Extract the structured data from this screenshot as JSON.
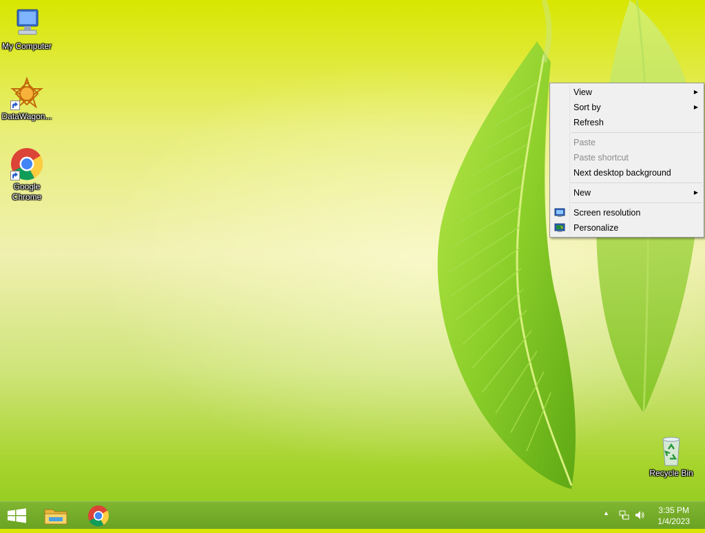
{
  "desktop": {
    "icons": [
      {
        "label": "My Computer"
      },
      {
        "label": "DataWagon..."
      },
      {
        "label": "Google Chrome"
      },
      {
        "label": "Recycle Bin"
      }
    ]
  },
  "context_menu": {
    "items": [
      {
        "label": "View",
        "has_submenu": true
      },
      {
        "label": "Sort by",
        "has_submenu": true
      },
      {
        "label": "Refresh"
      },
      {
        "label": "Paste",
        "disabled": true
      },
      {
        "label": "Paste shortcut",
        "disabled": true
      },
      {
        "label": "Next desktop background"
      },
      {
        "label": "New",
        "has_submenu": true
      },
      {
        "label": "Screen resolution",
        "icon": "screen-resolution-icon"
      },
      {
        "label": "Personalize",
        "icon": "personalize-icon"
      }
    ]
  },
  "taskbar": {
    "clock_time": "3:35 PM",
    "clock_date": "1/4/2023",
    "pinned": [
      "start-button",
      "file-explorer",
      "google-chrome"
    ]
  },
  "colors": {
    "taskbar": "#6aa323",
    "menu_bg": "#f0f0f0"
  }
}
